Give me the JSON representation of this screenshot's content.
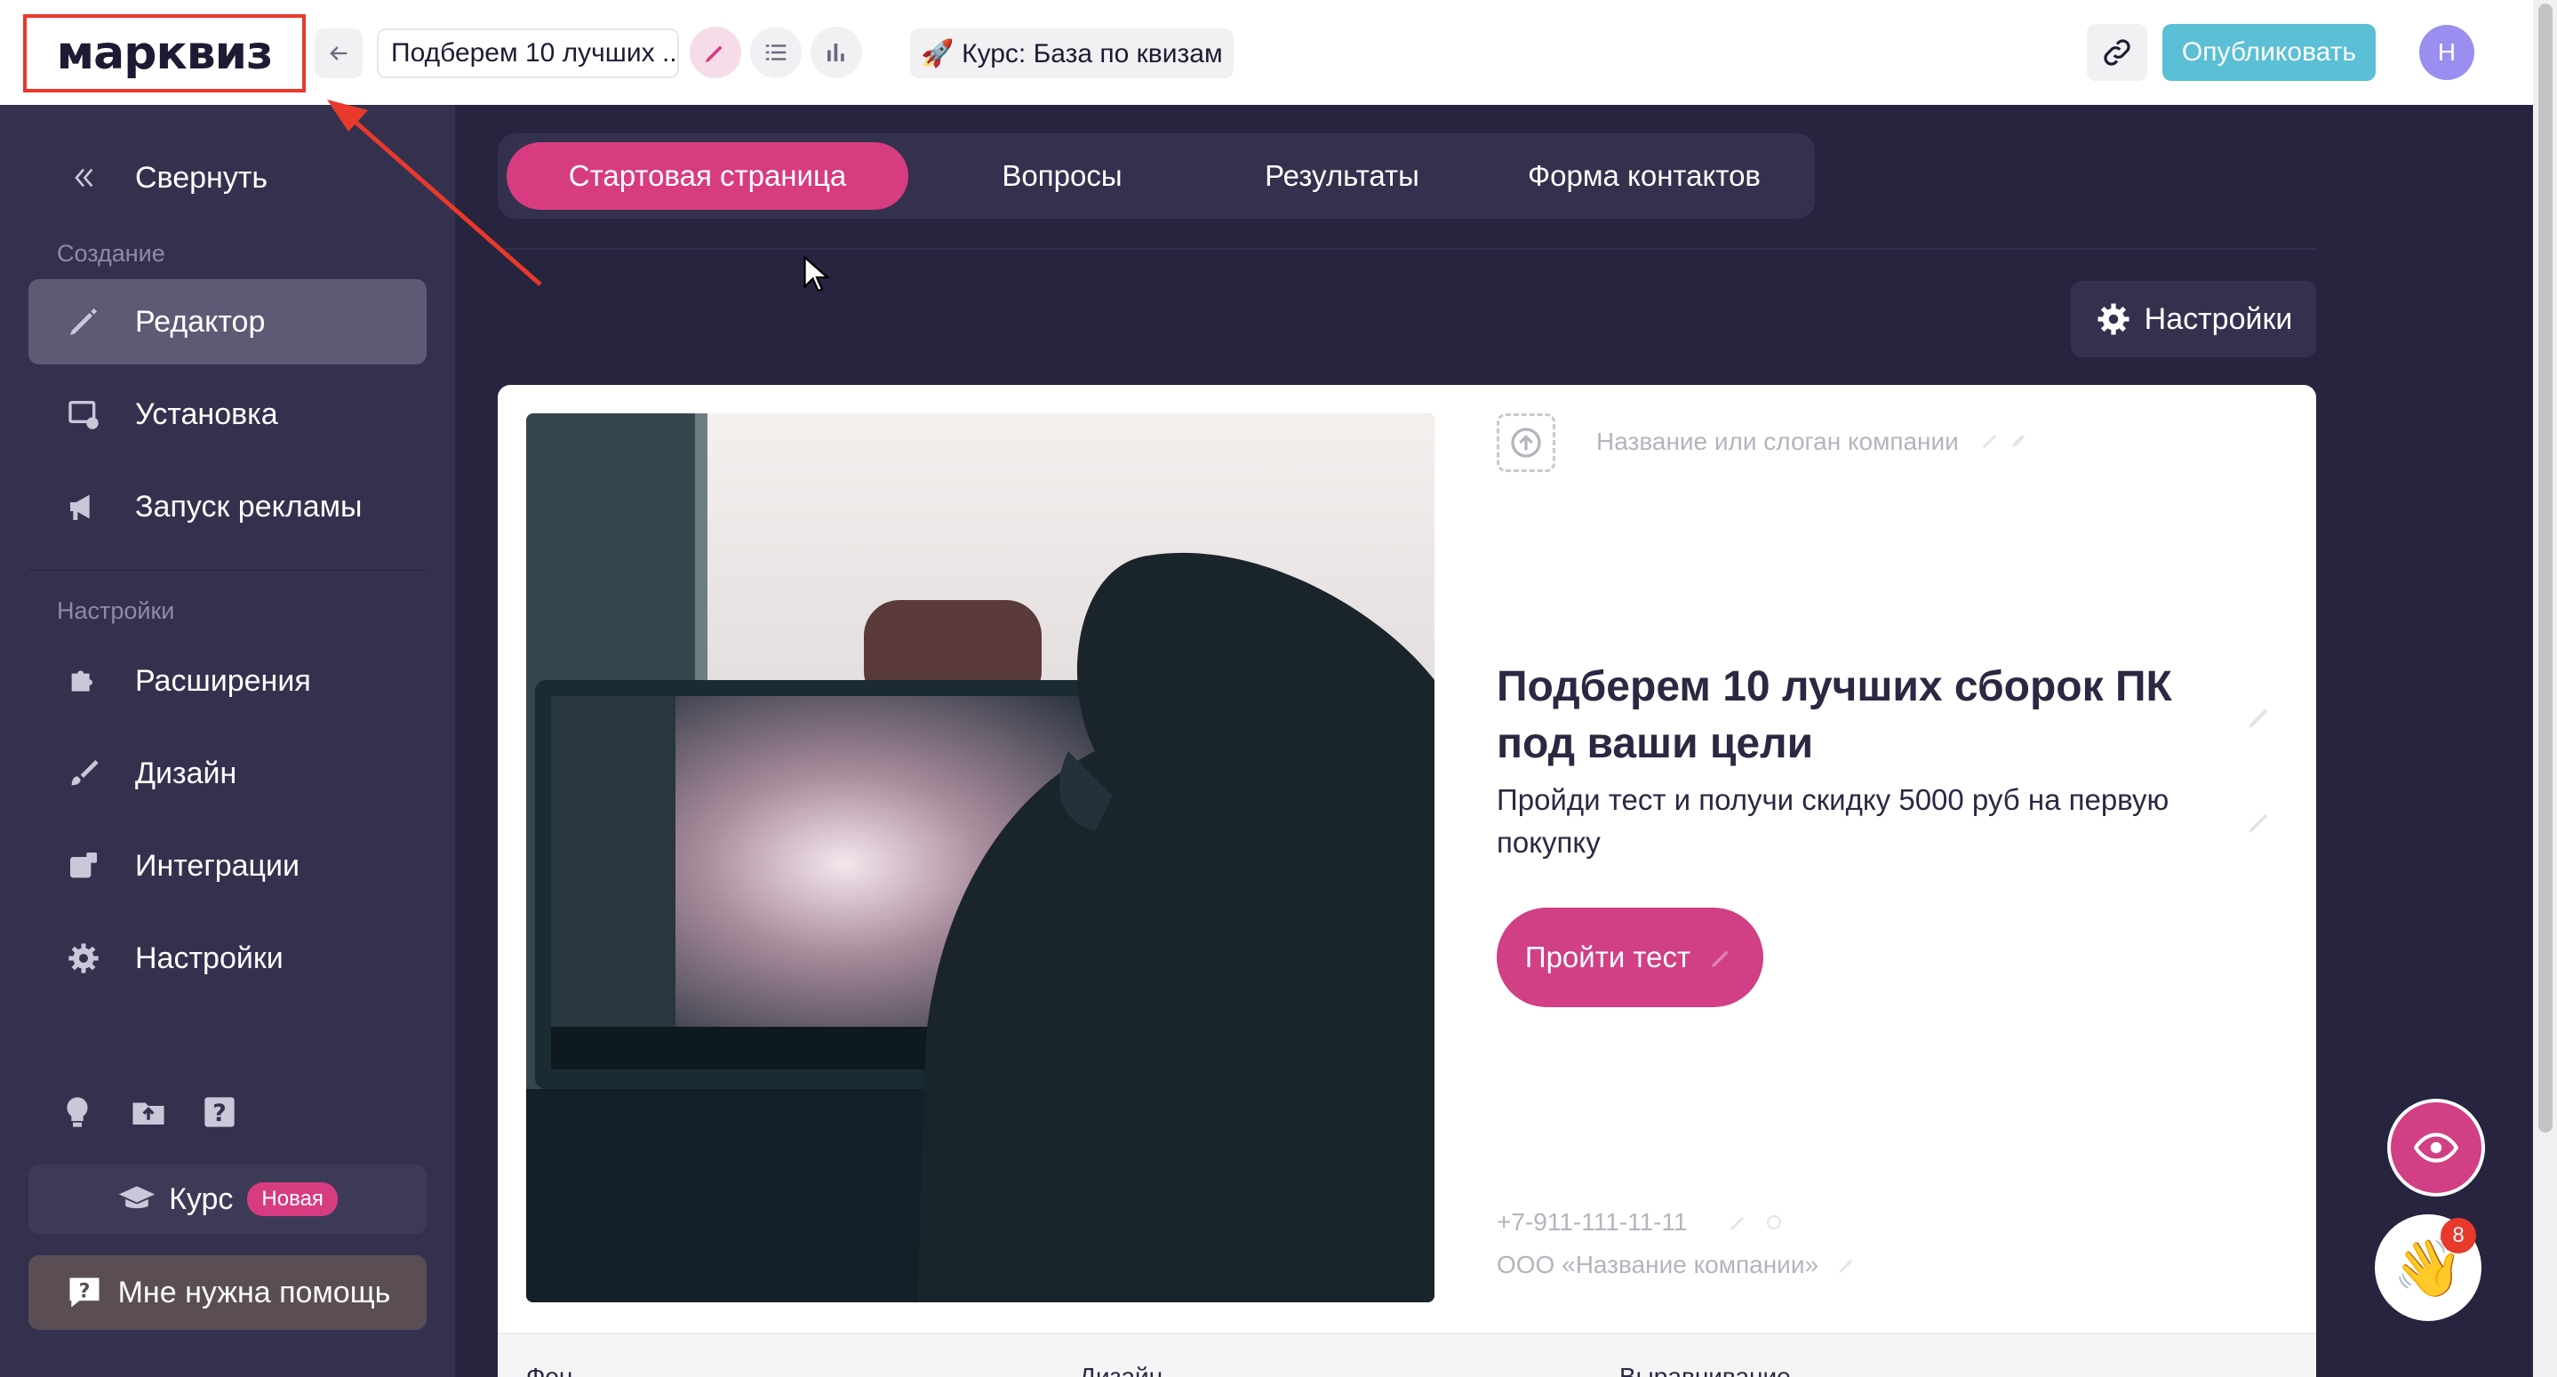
{
  "header": {
    "logo": "марквиз",
    "quiz_title": "Подберем 10 лучших ...",
    "course_link": "🚀 Курс: База по квизам",
    "publish_label": "Опубликовать",
    "avatar_initial": "Н"
  },
  "sidebar": {
    "collapse_label": "Свернуть",
    "section_create": "Создание",
    "items_create": [
      {
        "label": "Редактор",
        "icon": "pencil-icon"
      },
      {
        "label": "Установка",
        "icon": "install-icon"
      },
      {
        "label": "Запуск рекламы",
        "icon": "megaphone-icon"
      }
    ],
    "section_settings": "Настройки",
    "items_settings": [
      {
        "label": "Расширения",
        "icon": "puzzle-icon"
      },
      {
        "label": "Дизайн",
        "icon": "brush-icon"
      },
      {
        "label": "Интеграции",
        "icon": "integration-icon"
      },
      {
        "label": "Настройки",
        "icon": "gear-icon"
      }
    ],
    "course_label": "Курс",
    "course_badge": "Новая",
    "help_label": "Мне нужна помощь"
  },
  "tabs": [
    {
      "label": "Стартовая страница",
      "active": true
    },
    {
      "label": "Вопросы",
      "active": false
    },
    {
      "label": "Результаты",
      "active": false
    },
    {
      "label": "Форма контактов",
      "active": false
    }
  ],
  "settings_label": "Настройки",
  "start_page": {
    "slogan_placeholder": "Название или слоган компании",
    "headline": "Подберем 10 лучших сборок ПК под ваши цели",
    "subheadline": "Пройди тест и получи скидку 5000 руб на первую покупку",
    "cta_label": "Пройти тест",
    "phone": "+7-911-111-11-11",
    "company": "ООО «Название компании»"
  },
  "footer_labels": [
    "Фон",
    "Дизайн",
    "Выравнивание"
  ],
  "chat_badge": "8",
  "colors": {
    "accent": "#d73b80",
    "sidebar_bg": "#34314f",
    "page_bg": "#26243f",
    "publish": "#5bbfd6",
    "annotation": "#e8392b"
  }
}
